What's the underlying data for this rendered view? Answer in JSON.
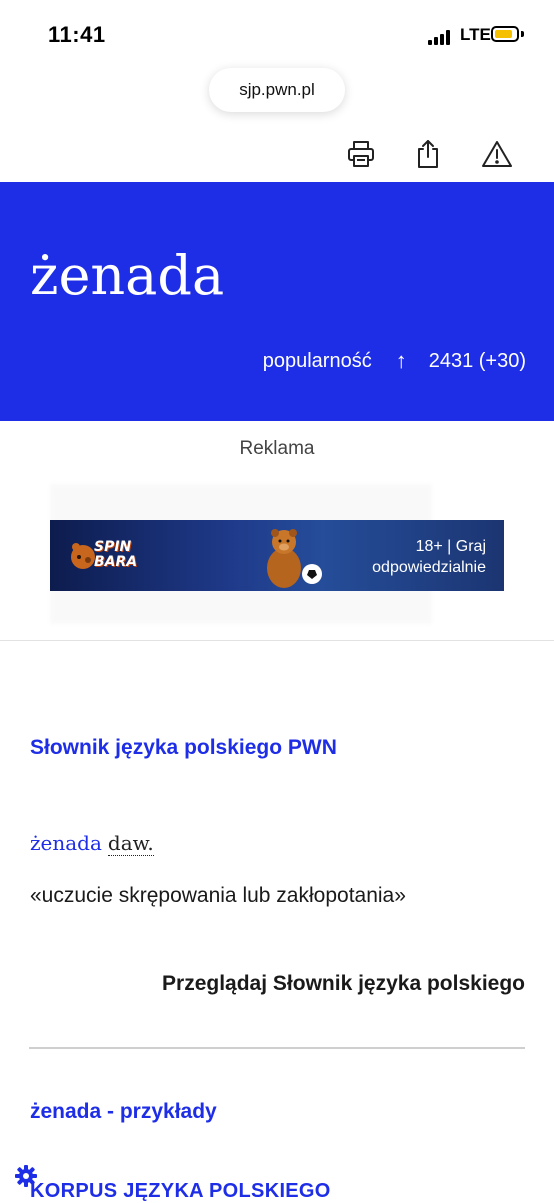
{
  "status": {
    "time": "11:41",
    "network": "LTE"
  },
  "browser": {
    "url": "sjp.pwn.pl"
  },
  "toolbar": {
    "icons": [
      "print-icon",
      "share-icon",
      "report-icon"
    ]
  },
  "hero": {
    "headword": "żenada",
    "popularity_label": "popularność",
    "popularity_arrow": "↑",
    "popularity_value": "2431 (+30)"
  },
  "ad": {
    "label": "Reklama",
    "banner_logo_line1": "SPIN",
    "banner_logo_line2": "BARA",
    "banner_age_line1": "18+ | Graj",
    "banner_age_line2": "odpowiedzialnie"
  },
  "colors": {
    "brand": "#1e2ee6",
    "battery": "#f4c000"
  },
  "dictionary": {
    "title": "Słownik języka polskiego PWN",
    "entry_word": "żenada",
    "entry_qualifier": "daw.",
    "definition": "«uczucie skrępowania lub zakłopotania»",
    "browse_link": "Przeglądaj Słownik języka polskiego"
  },
  "examples": {
    "title": "żenada - przykłady",
    "corpus_label": "KORPUS JĘZYKA POLSKIEGO"
  }
}
